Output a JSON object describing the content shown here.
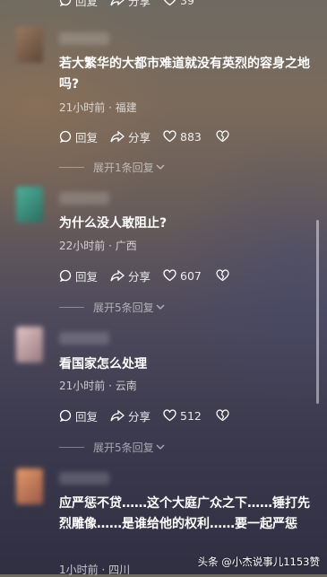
{
  "top_row": {
    "reply_label": "回复",
    "share_label": "分享",
    "like_count": "39"
  },
  "comments": [
    {
      "text": "若大繁华的大都市难道就没有英烈的容身之地吗?",
      "meta": "21小时前 · 福建",
      "reply_label": "回复",
      "share_label": "分享",
      "like_count": "883",
      "expand_label": "展开1条回复"
    },
    {
      "text": "为什么没人敢阻止?",
      "meta": "22小时前 · 广西",
      "reply_label": "回复",
      "share_label": "分享",
      "like_count": "607",
      "expand_label": "展开5条回复"
    },
    {
      "text": "看国家怎么处理",
      "meta": "21小时前 · 云南",
      "reply_label": "回复",
      "share_label": "分享",
      "like_count": "512",
      "expand_label": "展开5条回复"
    },
    {
      "text": "应严惩不贷……这个大庭广众之下……锤打先烈雕像……是谁给他的权利……要一起严惩",
      "meta": "1小时前 · 四川"
    }
  ],
  "watermark": "头条 @小杰说事儿1153赞",
  "colors": {
    "avatar_1": "#8a6a55",
    "avatar_2": "#3f9c8a",
    "avatar_3": "#c8a8a8",
    "avatar_4": "#d4845a"
  }
}
